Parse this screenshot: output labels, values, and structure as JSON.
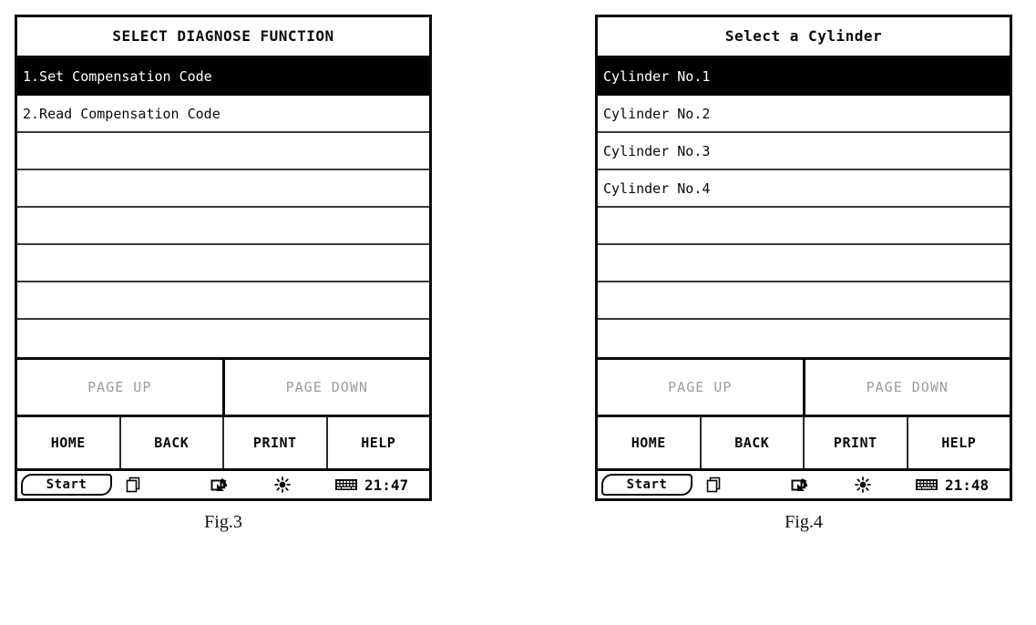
{
  "figures": [
    {
      "id": "fig3",
      "caption": "Fig.3",
      "screen": {
        "title": "SELECT DIAGNOSE FUNCTION",
        "rows": [
          {
            "label": "1.Set Compensation Code",
            "selected": true,
            "empty": false
          },
          {
            "label": "2.Read Compensation Code",
            "selected": false,
            "empty": false
          },
          {
            "label": "",
            "selected": false,
            "empty": true
          },
          {
            "label": "",
            "selected": false,
            "empty": true
          },
          {
            "label": "",
            "selected": false,
            "empty": true
          },
          {
            "label": "",
            "selected": false,
            "empty": true
          },
          {
            "label": "",
            "selected": false,
            "empty": true
          },
          {
            "label": "",
            "selected": false,
            "empty": true
          }
        ],
        "paging": {
          "page_up": "PAGE UP",
          "page_down": "PAGE DOWN",
          "disabled_color": "#9d9d9d"
        },
        "function_keys": [
          "HOME",
          "BACK",
          "PRINT",
          "HELP"
        ],
        "taskbar": {
          "start_label": "Start",
          "icons": [
            "windows-icon",
            "rotate-screen-icon",
            "brightness-icon",
            "keyboard-icon"
          ],
          "clock": "21:47"
        }
      }
    },
    {
      "id": "fig4",
      "caption": "Fig.4",
      "screen": {
        "title": "Select a Cylinder",
        "rows": [
          {
            "label": "Cylinder No.1",
            "selected": true,
            "empty": false
          },
          {
            "label": "Cylinder No.2",
            "selected": false,
            "empty": false
          },
          {
            "label": "Cylinder No.3",
            "selected": false,
            "empty": false
          },
          {
            "label": "Cylinder No.4",
            "selected": false,
            "empty": false
          },
          {
            "label": "",
            "selected": false,
            "empty": true
          },
          {
            "label": "",
            "selected": false,
            "empty": true
          },
          {
            "label": "",
            "selected": false,
            "empty": true
          },
          {
            "label": "",
            "selected": false,
            "empty": true
          }
        ],
        "paging": {
          "page_up": "PAGE UP",
          "page_down": "PAGE DOWN",
          "disabled_color": "#9d9d9d"
        },
        "function_keys": [
          "HOME",
          "BACK",
          "PRINT",
          "HELP"
        ],
        "taskbar": {
          "start_label": "Start",
          "icons": [
            "windows-icon",
            "rotate-screen-icon",
            "brightness-icon",
            "keyboard-icon"
          ],
          "clock": "21:48"
        }
      }
    }
  ],
  "colors": {
    "frame": "#0a0a0a",
    "selection_bg": "#000000",
    "selection_fg": "#ffffff",
    "disabled_text": "#9d9d9d",
    "background": "#ffffff"
  }
}
